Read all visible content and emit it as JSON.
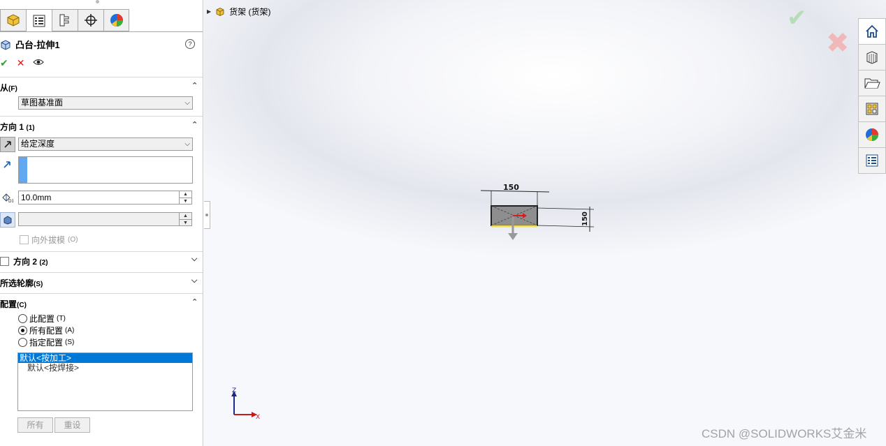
{
  "tabs": [
    {
      "icon": "feature-manager-icon"
    },
    {
      "icon": "property-manager-icon",
      "active": true
    },
    {
      "icon": "configuration-manager-icon"
    },
    {
      "icon": "dimxpert-icon"
    },
    {
      "icon": "display-manager-icon"
    }
  ],
  "feature": {
    "title": "凸台-拉伸1",
    "help": "?"
  },
  "actions": {
    "ok": "✔",
    "cancel": "✕",
    "preview": "👁"
  },
  "from": {
    "header": "从",
    "key": "(F)",
    "value": "草图基准面"
  },
  "direction1": {
    "header": "方向 1",
    "key": "(1)",
    "end_condition": "给定深度",
    "depth": "10.0mm",
    "draft_outward": "向外拔模",
    "draft_key": "(O)"
  },
  "direction2": {
    "header": "方向 2",
    "key": "(2)"
  },
  "contours": {
    "header": "所选轮廓",
    "key": "(S)"
  },
  "config": {
    "header": "配置",
    "key": "(C)",
    "options": [
      {
        "label": "此配置",
        "key": "(T)",
        "selected": false
      },
      {
        "label": "所有配置",
        "key": "(A)",
        "selected": true
      },
      {
        "label": "指定配置",
        "key": "(S)",
        "selected": false
      }
    ],
    "list": [
      "默认<按加工>",
      "默认<按焊接>"
    ],
    "all_button": "所有",
    "reset_button": "重设"
  },
  "tree": {
    "label": "货架 (货架)"
  },
  "sketch": {
    "dim_h": "150",
    "dim_v": "150"
  },
  "triad": {
    "z": "Z",
    "x": "X"
  },
  "watermark": "CSDN @SOLIDWORKS艾金米",
  "colors": {
    "ok": "#3a9a3a",
    "cancel": "#d21f1f",
    "selection": "#0078d7",
    "sketch_fill": "#8e8e8e",
    "sketch_edge": "#f2e04a"
  }
}
